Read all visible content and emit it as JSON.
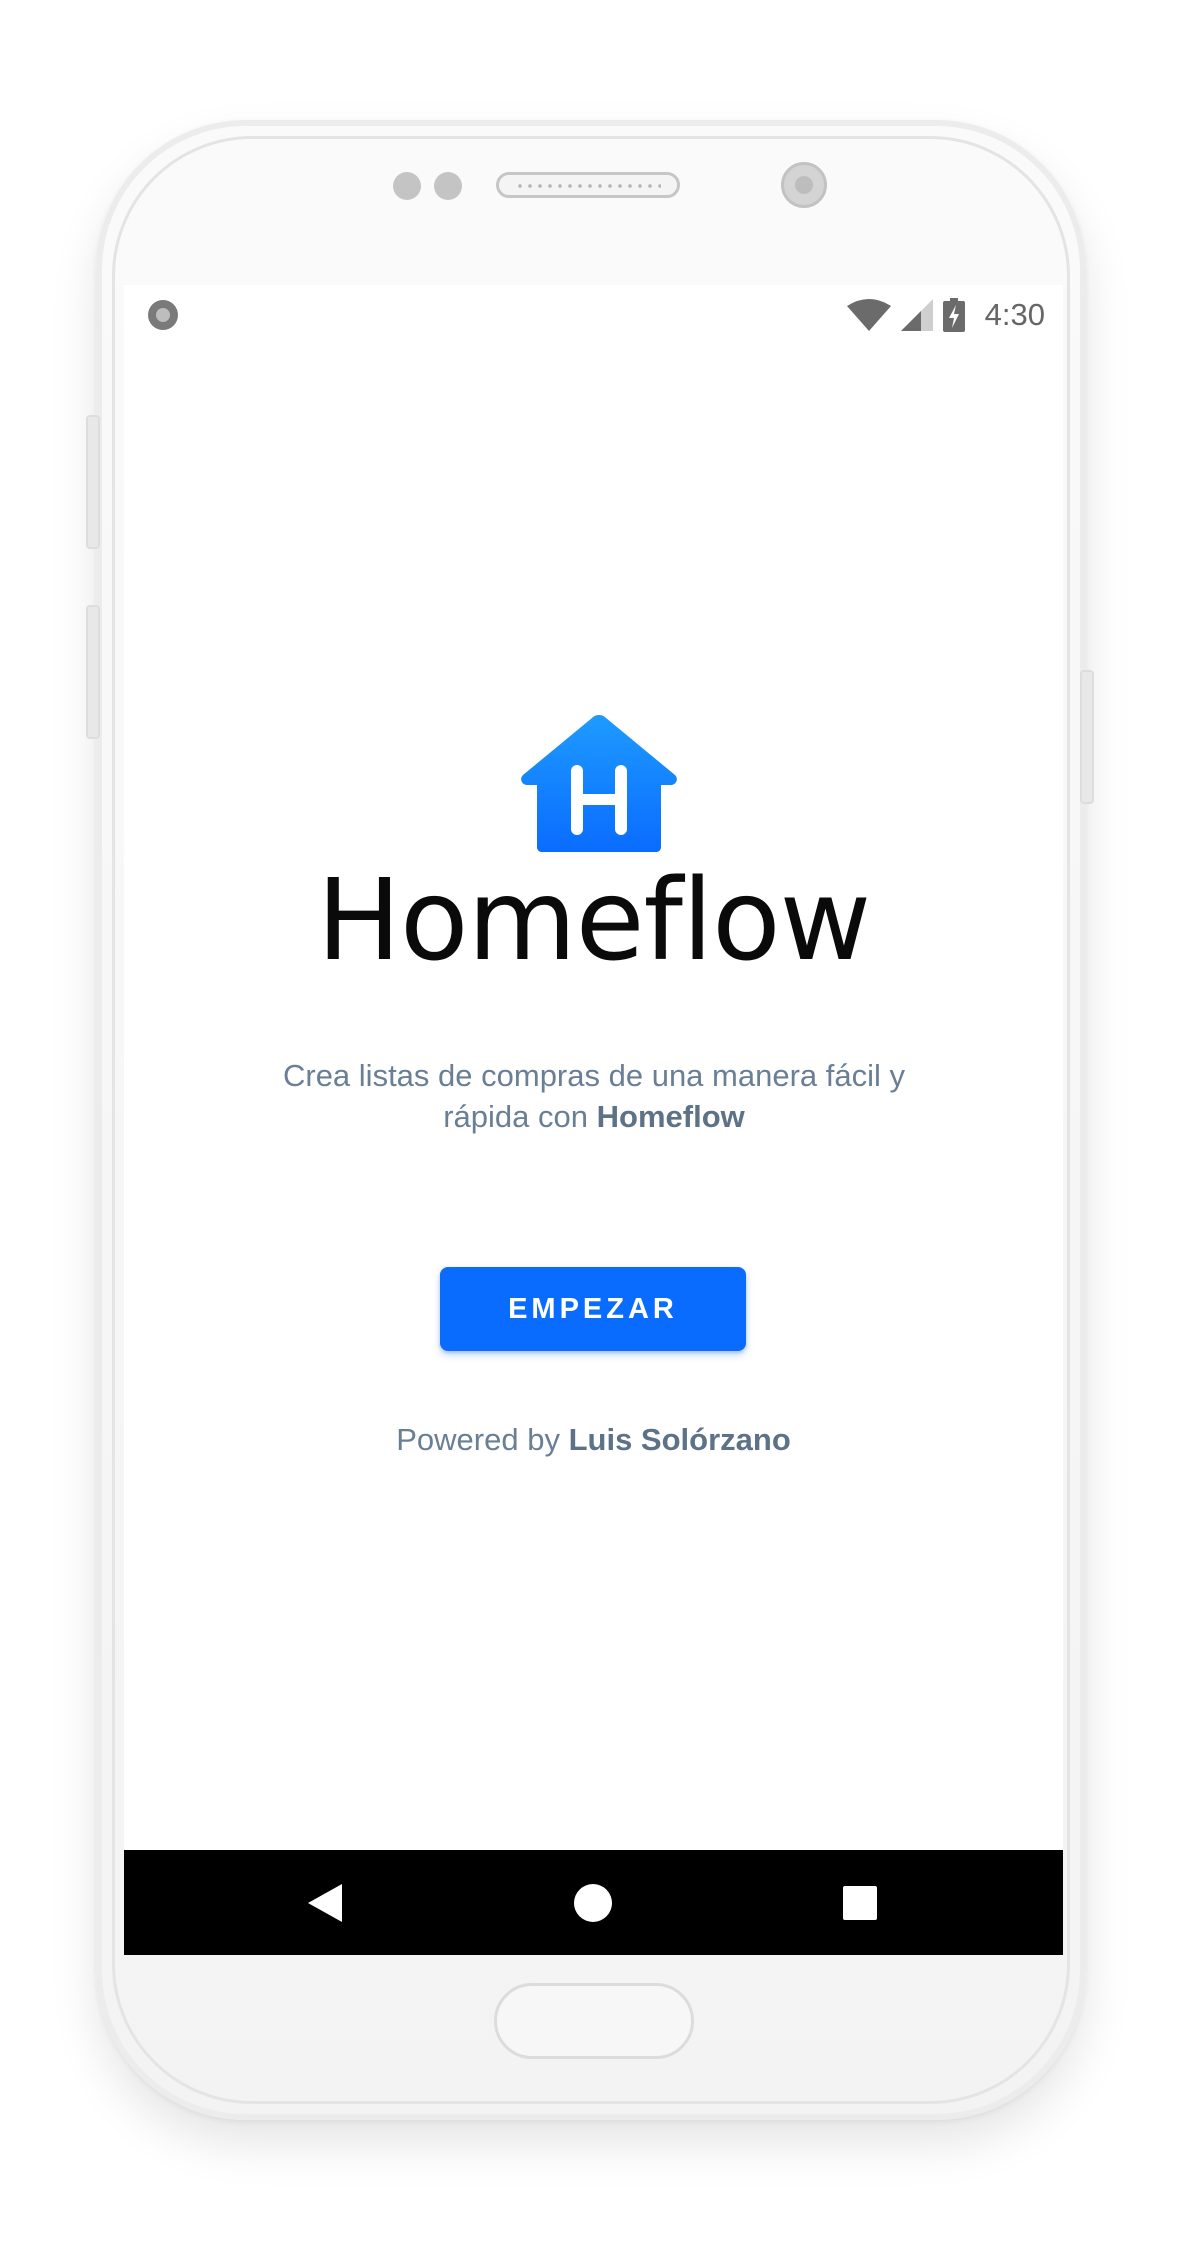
{
  "status_bar": {
    "time": "4:30",
    "icons": [
      "notification-dot-icon",
      "wifi-icon",
      "signal-icon",
      "battery-charging-icon"
    ]
  },
  "app": {
    "logo_icon": "house-h-logo-icon",
    "title": "Homeflow",
    "tagline_text": "Crea listas de compras de una manera fácil y rápida con",
    "tagline_brand": "Homeflow",
    "start_button_label": "EMPEZAR",
    "powered_prefix": "Powered by",
    "powered_author": "Luis Solórzano"
  },
  "navigation_bar": {
    "buttons": [
      {
        "name": "back",
        "icon": "back-triangle-icon"
      },
      {
        "name": "home",
        "icon": "home-circle-icon"
      },
      {
        "name": "recents",
        "icon": "recents-square-icon"
      }
    ]
  },
  "colors": {
    "accent": "#0A6CFF",
    "logo_gradient_top": "#1E9BFF",
    "logo_gradient_bottom": "#0A6CFF",
    "text_secondary": "#6A7F95",
    "title": "#0A0A0A",
    "nav_bar": "#000000"
  }
}
